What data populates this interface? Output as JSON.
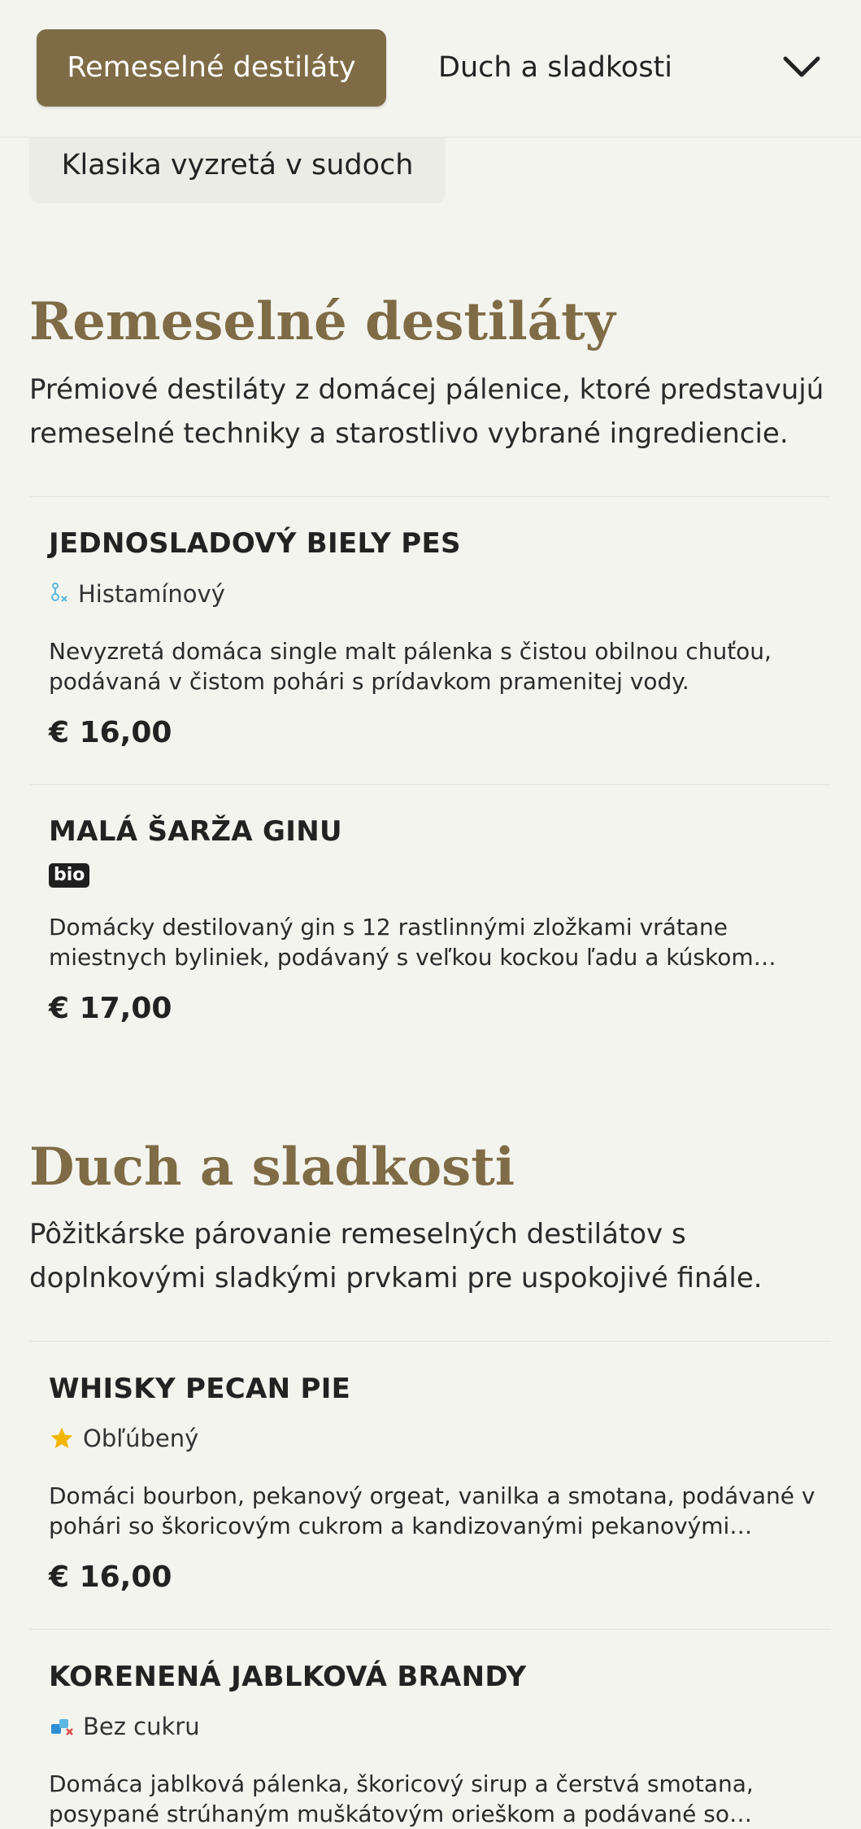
{
  "tabs": {
    "active": "Remeselné destiláty",
    "second": "Duch a sladkosti",
    "third": "Klasika vyzretá v sudoch"
  },
  "sections": [
    {
      "title": "Remeselné destiláty",
      "description": "Prémiové destiláty z domácej pálenice, ktoré predstavujú remeselné techniky a starostlivo vybrané ingrediencie.",
      "items": [
        {
          "name": "JEDNOSLADOVÝ BIELY PES",
          "tag": "Histamínový",
          "tag_icon": "histamine-icon",
          "description": "Nevyzretá domáca single malt pálenka s čistou obilnou chuťou, podávaná v čistom pohári s prídavkom pramenitej vody.",
          "price": "€ 16,00"
        },
        {
          "name": "MALÁ ŠARŽA GINU",
          "tag": "bio",
          "tag_icon": "bio-badge",
          "description": "Domácky destilovaný gin s 12 rastlinnými zložkami vrátane miestnych byliniek, podávaný s veľkou kockou ľadu a kúskom…",
          "price": "€ 17,00"
        }
      ]
    },
    {
      "title": "Duch a sladkosti",
      "description": "Pôžitkárske párovanie remeselných destilátov s doplnkovými sladkými prvkami pre uspokojivé finále.",
      "items": [
        {
          "name": "WHISKY PECAN PIE",
          "tag": "Obľúbený",
          "tag_icon": "star-icon",
          "description": "Domáci bourbon, pekanový orgeat, vanilka a smotana, podávané v pohári so škoricovým cukrom a kandizovanými pekanovými…",
          "price": "€ 16,00"
        },
        {
          "name": "KORENENÁ JABLKOVÁ BRANDY",
          "tag": "Bez cukru",
          "tag_icon": "sugar-free-icon",
          "description": "Domáca jablková pálenka, škoricový sirup a čerstvá smotana, posypané strúhaným muškátovým orieškom a podávané so…",
          "price": ""
        }
      ]
    }
  ],
  "colors": {
    "accent": "#7f6c46",
    "background": "#f4f4ef",
    "star": "#f2b600",
    "histamine": "#5bb8e0"
  }
}
